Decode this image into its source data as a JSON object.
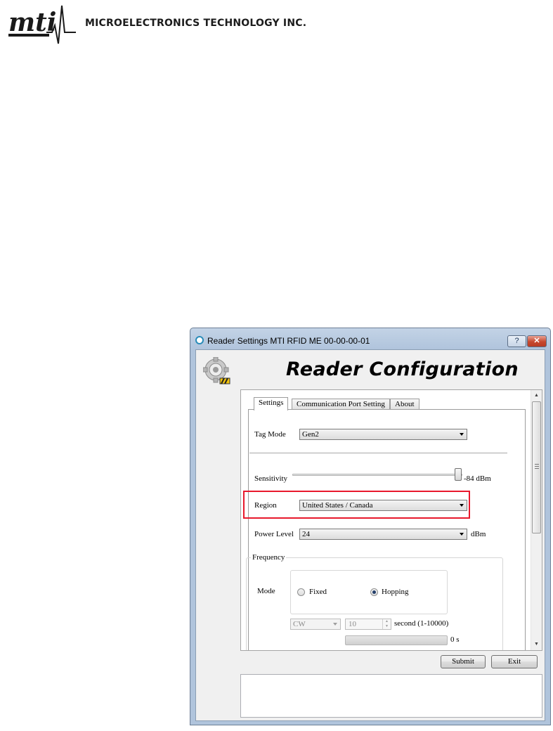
{
  "header": {
    "logo_text": "MTI",
    "company_name": "MICROELECTRONICS TECHNOLOGY INC."
  },
  "window": {
    "title": "Reader Settings MTI RFID ME 00-00-00-01",
    "help_label": "?",
    "close_label": "✕",
    "heading": "Reader Configuration"
  },
  "tabs": [
    {
      "label": "Settings",
      "active": true
    },
    {
      "label": "Communication Port Setting",
      "active": false
    },
    {
      "label": "About",
      "active": false
    }
  ],
  "settings": {
    "tag_mode_label": "Tag Mode",
    "tag_mode_value": "Gen2",
    "sensitivity_label": "Sensitivity",
    "sensitivity_value": "-84 dBm",
    "region_label": "Region",
    "region_value": "United States / Canada",
    "power_level_label": "Power Level",
    "power_level_value": "24",
    "power_unit": "dBm"
  },
  "frequency": {
    "group_label": "Frequency",
    "mode_label": "Mode",
    "fixed_label": "Fixed",
    "hopping_label": "Hopping",
    "selected_mode": "Hopping",
    "cw_value": "CW",
    "duration_value": "10",
    "duration_unit": "second (1-10000)",
    "elapsed_value": "0 s"
  },
  "buttons": {
    "submit_label": "Submit",
    "exit_label": "Exit"
  },
  "colors": {
    "highlight": "#e8192c",
    "titlebar": "#b9cbe0",
    "close_button": "#c6482f"
  }
}
